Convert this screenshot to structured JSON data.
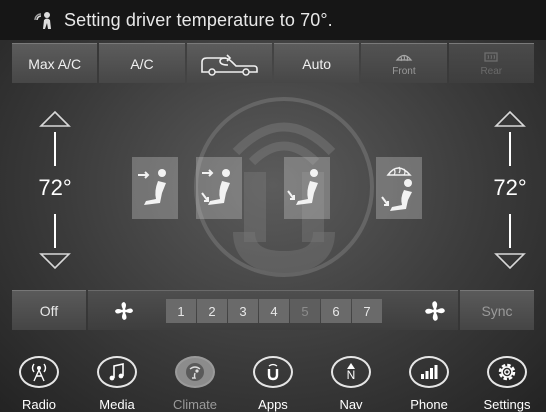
{
  "status": {
    "voice_icon": "voice-command-icon",
    "message": "Setting driver temperature to 70°."
  },
  "top_buttons": {
    "max_ac": "Max A/C",
    "ac": "A/C",
    "recirc_icon": "recirculation-icon",
    "auto": "Auto",
    "front": "Front",
    "rear": "Rear"
  },
  "temperature": {
    "driver": "72°",
    "passenger": "72°"
  },
  "airflow_modes": [
    "panel",
    "bi-level",
    "floor",
    "mix-defrost"
  ],
  "fan": {
    "off": "Off",
    "levels": [
      "1",
      "2",
      "3",
      "4",
      "5",
      "6",
      "7"
    ],
    "current_level": 4,
    "sync": "Sync"
  },
  "nav": {
    "radio": "Radio",
    "media": "Media",
    "climate": "Climate",
    "apps": "Apps",
    "nav": "Nav",
    "nav_icon_letter": "N",
    "phone": "Phone",
    "settings": "Settings"
  }
}
